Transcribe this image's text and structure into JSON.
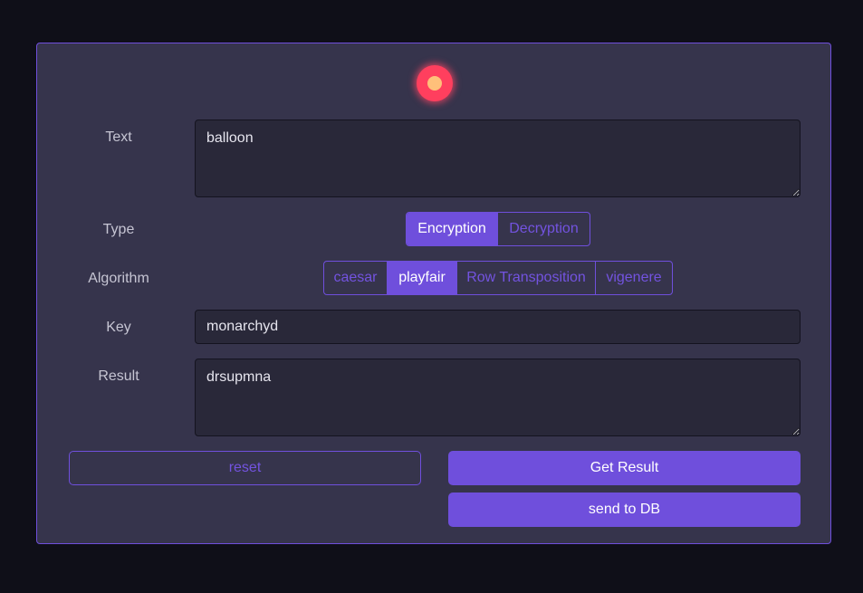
{
  "form": {
    "text_label": "Text",
    "text_value": "balloon",
    "type_label": "Type",
    "type_options": [
      "Encryption",
      "Decryption"
    ],
    "type_selected": "Encryption",
    "algorithm_label": "Algorithm",
    "algorithm_options": [
      "caesar",
      "playfair",
      "Row Transposition",
      "vigenere"
    ],
    "algorithm_selected": "playfair",
    "key_label": "Key",
    "key_value": "monarchyd",
    "result_label": "Result",
    "result_value": "drsupmna"
  },
  "actions": {
    "reset_label": "reset",
    "get_result_label": "Get Result",
    "send_label": "send to DB"
  },
  "colors": {
    "accent": "#6f4fdc",
    "card_bg": "#36344c",
    "page_bg": "#0f0f18",
    "status_dot": "#ff3f5e"
  }
}
